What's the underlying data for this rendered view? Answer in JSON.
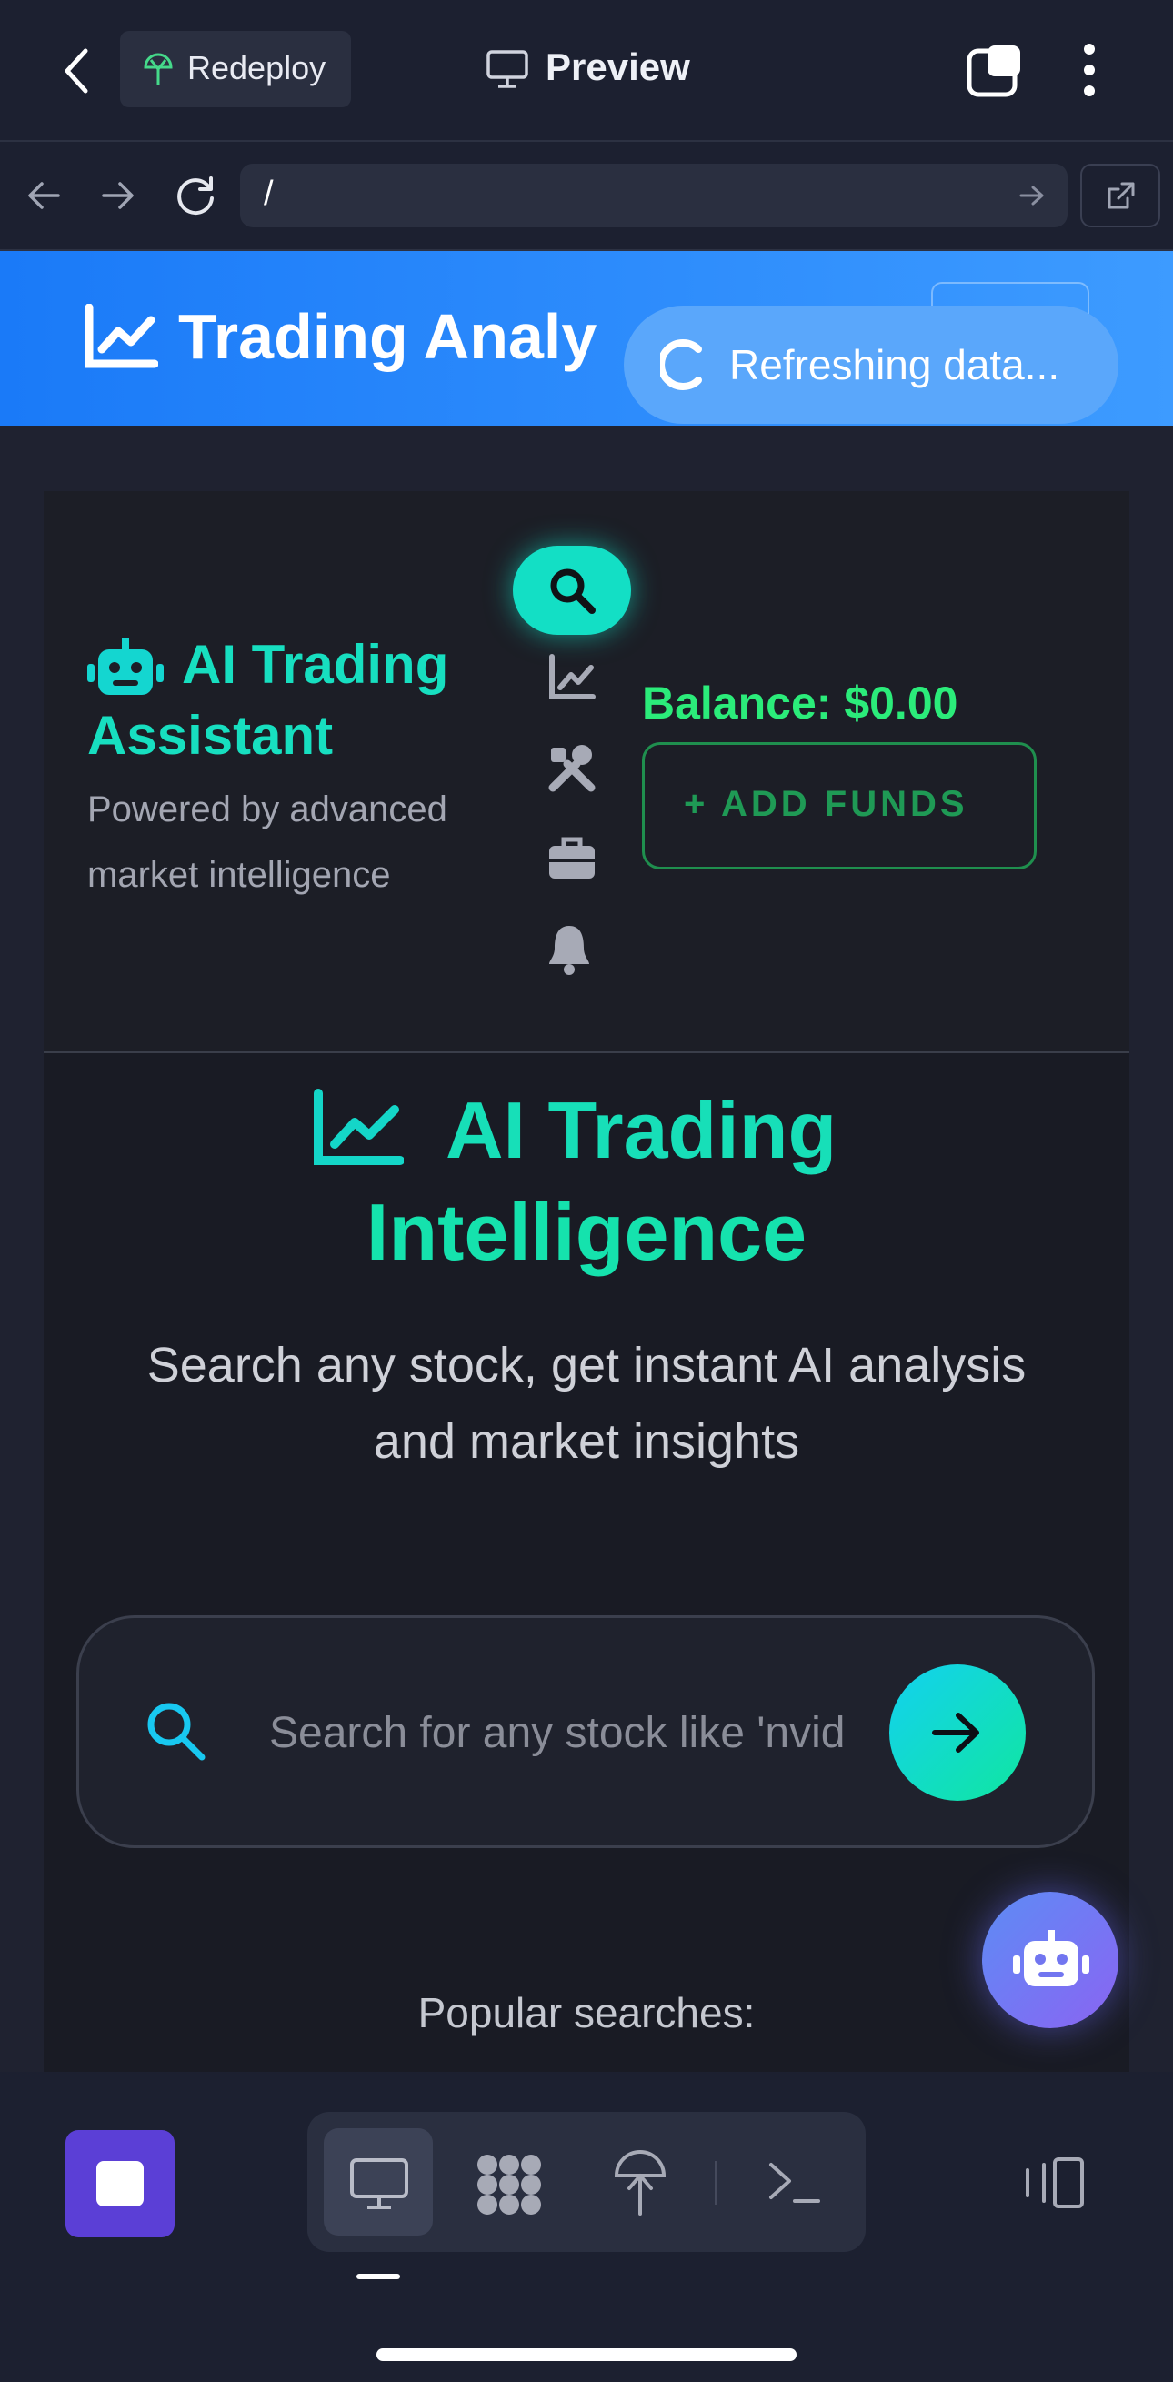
{
  "topbar": {
    "redeploy_label": "Redeploy",
    "preview_label": "Preview"
  },
  "urlbar": {
    "path": "/"
  },
  "header": {
    "title": "Trading Analy",
    "toast": "Refreshing data..."
  },
  "assistant": {
    "title_line1": "AI Trading",
    "title_line2": "Assistant",
    "subtitle_line1": "Powered by advanced",
    "subtitle_line2": "market intelligence",
    "balance": "Balance: $0.00",
    "add_funds": "+ ADD FUNDS"
  },
  "hero": {
    "title_line1": "AI Trading",
    "title_line2": "Intelligence",
    "desc_line1": "Search any stock, get instant AI analysis",
    "desc_line2": "and market insights"
  },
  "search": {
    "placeholder": "Search for any stock like 'nvid"
  },
  "popular_label": "Popular searches:",
  "colors": {
    "accent_teal": "#13dfc5",
    "balance_green": "#2bec7a",
    "header_blue": "#1a7af8",
    "stop_purple": "#5b3fd6"
  }
}
